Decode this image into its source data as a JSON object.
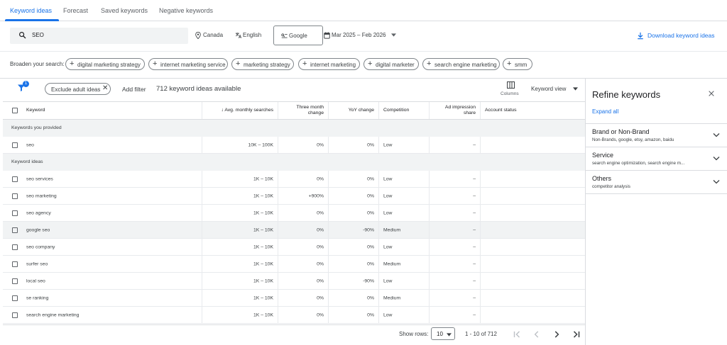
{
  "tabs": [
    {
      "label": "Keyword ideas",
      "active": true
    },
    {
      "label": "Forecast",
      "active": false
    },
    {
      "label": "Saved keywords",
      "active": false
    },
    {
      "label": "Negative keywords",
      "active": false
    }
  ],
  "search": {
    "value": "SEO",
    "icon": "search-icon"
  },
  "targeting": {
    "location": "Canada",
    "language": "English",
    "network": "Google",
    "date_range": "Mar 2025 – Feb 2026"
  },
  "download_label": "Download keyword ideas",
  "broaden": {
    "label": "Broaden your search:",
    "chips": [
      "digital marketing strategy",
      "internet marketing service",
      "marketing strategy",
      "internet marketing",
      "digital marketer",
      "search engine marketing",
      "smm"
    ]
  },
  "filters": {
    "badge_count": "1",
    "exclude_chip": "Exclude adult ideas",
    "add_filter": "Add filter",
    "ideas_count": "712 keyword ideas available",
    "columns_label": "Columns",
    "view_label": "Keyword view"
  },
  "table": {
    "headers": {
      "keyword": "Keyword",
      "avg": "Avg. monthly searches",
      "three_month_1": "Three month",
      "three_month_2": "change",
      "yoy": "YoY change",
      "competition": "Competition",
      "ad_share_1": "Ad impression",
      "ad_share_2": "share",
      "account_status": "Account status"
    },
    "section_provided": "Keywords you provided",
    "section_ideas": "Keyword ideas",
    "provided_rows": [
      {
        "keyword": "seo",
        "avg": "10K – 100K",
        "three": "0%",
        "yoy": "0%",
        "comp": "Low",
        "share": "–"
      }
    ],
    "idea_rows": [
      {
        "keyword": "seo services",
        "avg": "1K – 10K",
        "three": "0%",
        "yoy": "0%",
        "comp": "Low",
        "share": "–"
      },
      {
        "keyword": "seo marketing",
        "avg": "1K – 10K",
        "three": "+900%",
        "yoy": "0%",
        "comp": "Low",
        "share": "–"
      },
      {
        "keyword": "seo agency",
        "avg": "1K – 10K",
        "three": "0%",
        "yoy": "0%",
        "comp": "Low",
        "share": "–"
      },
      {
        "keyword": "google seo",
        "avg": "1K – 10K",
        "three": "0%",
        "yoy": "-90%",
        "comp": "Medium",
        "share": "–"
      },
      {
        "keyword": "seo company",
        "avg": "1K – 10K",
        "three": "0%",
        "yoy": "0%",
        "comp": "Low",
        "share": "–"
      },
      {
        "keyword": "surfer seo",
        "avg": "1K – 10K",
        "three": "0%",
        "yoy": "0%",
        "comp": "Medium",
        "share": "–"
      },
      {
        "keyword": "local seo",
        "avg": "1K – 10K",
        "three": "0%",
        "yoy": "-90%",
        "comp": "Low",
        "share": "–"
      },
      {
        "keyword": "se ranking",
        "avg": "1K – 10K",
        "three": "0%",
        "yoy": "0%",
        "comp": "Medium",
        "share": "–"
      },
      {
        "keyword": "search engine marketing",
        "avg": "1K – 10K",
        "three": "0%",
        "yoy": "0%",
        "comp": "Low",
        "share": "–"
      }
    ]
  },
  "pagination": {
    "show_rows_label": "Show rows:",
    "rows_value": "10",
    "range": "1 - 10 of 712"
  },
  "refine": {
    "title": "Refine keywords",
    "expand_all": "Expand all",
    "facets": [
      {
        "title": "Brand or Non-Brand",
        "subtitle": "Non-Brands, google, etsy, amazon, baidu"
      },
      {
        "title": "Service",
        "subtitle": "search engine optimization, search engine m..."
      },
      {
        "title": "Others",
        "subtitle": "competitor analysis"
      }
    ]
  },
  "colors": {
    "accent": "#1a73e8",
    "text": "#202124",
    "muted": "#5f6368",
    "divider": "#dadce0",
    "row_highlight": "#f1f3f4"
  }
}
